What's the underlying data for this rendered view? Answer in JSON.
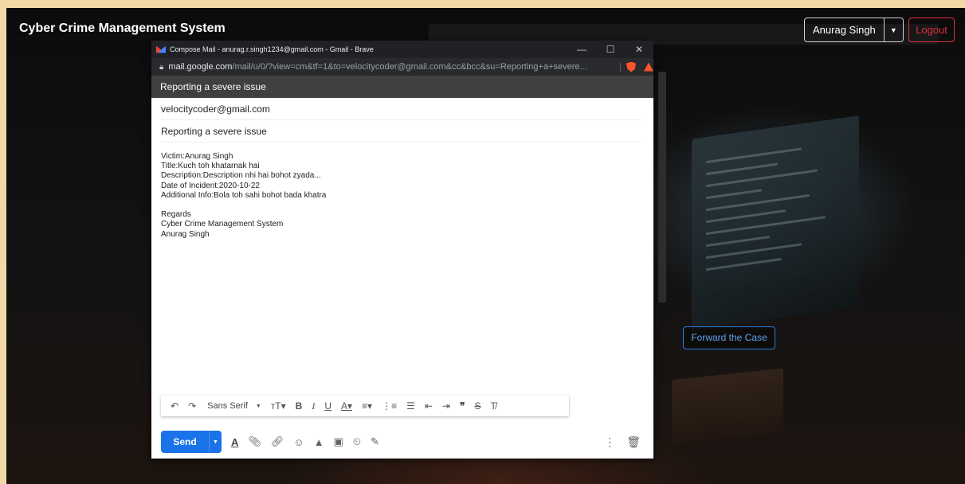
{
  "app": {
    "title": "Cyber Crime Management System",
    "user_name": "Anurag Singh",
    "logout_label": "Logout",
    "forward_label": "Forward the Case"
  },
  "popup": {
    "window_title": "Compose Mail - anurag.r.singh1234@gmail.com - Gmail - Brave",
    "url_host": "mail.google.com",
    "url_path": "/mail/u/0/?view=cm&tf=1&to=velocitycoder@gmail.com&cc&bcc&su=Reporting+a+severe...",
    "compose_header": "Reporting a severe issue",
    "to": "velocitycoder@gmail.com",
    "subject": "Reporting a severe issue",
    "body_lines": [
      "Victim:Anurag Singh",
      "Title:Kuch toh khatarnak hai",
      "Description:Description nhi hai bohot  zyada...",
      "Date of Incident:2020-10-22",
      "Additional Info:Bola toh sahi bohot bada khatra",
      "",
      "Regards",
      "Cyber Crime Management System",
      "Anurag Singh"
    ],
    "font_name": "Sans Serif",
    "send_label": "Send"
  },
  "icons": {
    "window_controls": [
      "minimize-icon",
      "maximize-icon",
      "close-icon"
    ],
    "format_tools": [
      "undo-icon",
      "redo-icon",
      "font-size-icon",
      "bold-icon",
      "italic-icon",
      "underline-icon",
      "text-color-icon",
      "align-icon",
      "numbered-list-icon",
      "bulleted-list-icon",
      "indent-less-icon",
      "indent-more-icon",
      "quote-icon",
      "strikethrough-icon",
      "remove-formatting-icon"
    ],
    "bottom_tools": [
      "formatting-options-icon",
      "attach-icon",
      "link-icon",
      "emoji-icon",
      "drive-icon",
      "photo-icon",
      "confidential-icon",
      "signature-icon",
      "more-options-icon",
      "discard-icon"
    ]
  },
  "colors": {
    "send_blue": "#1a73e8",
    "logout_red": "#d9303d",
    "forward_blue": "#2a7de1",
    "compose_header": "#404040"
  }
}
